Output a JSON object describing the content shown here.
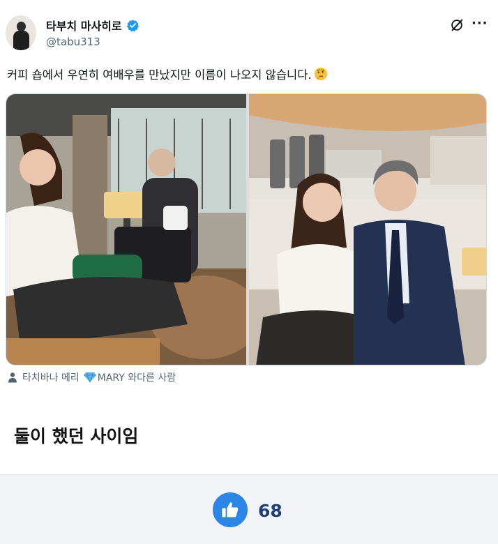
{
  "author": {
    "display_name": "타부치 마사히로",
    "handle": "@tabu313",
    "verified": true,
    "verified_color": "#1d9bf0"
  },
  "tweet": {
    "text": "커피 숍에서 우연히 여배우를 만났지만 이름이 나오지 않습니다.",
    "emoji": "thinking-face",
    "media_count": 2
  },
  "tags": {
    "person_icon": "person-icon",
    "first": "타치바나 메리",
    "gem_icon": "gem-icon",
    "second": "MARY 와다른 사람"
  },
  "caption": "둘이 했던 사이임",
  "reaction": {
    "icon": "thumbs-up-icon",
    "count": "68",
    "accent": "#2b86e8"
  }
}
